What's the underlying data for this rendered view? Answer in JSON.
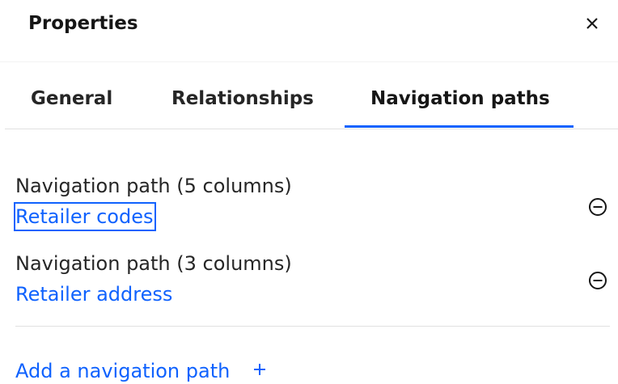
{
  "header": {
    "title": "Properties",
    "close_icon": "close-icon"
  },
  "tabs": [
    {
      "label": "General",
      "active": false
    },
    {
      "label": "Relationships",
      "active": false
    },
    {
      "label": "Navigation paths",
      "active": true
    }
  ],
  "navigation_paths": [
    {
      "heading": "Navigation path (5 columns)",
      "link": "Retailer codes",
      "focused": true,
      "remove_icon": "minus-circle-icon"
    },
    {
      "heading": "Navigation path (3 columns)",
      "link": "Retailer address",
      "focused": false,
      "remove_icon": "minus-circle-icon"
    }
  ],
  "add_action": {
    "label": "Add a navigation path",
    "icon": "plus-icon"
  },
  "colors": {
    "link": "#0f62fe",
    "text": "#262626",
    "divider": "#e0e0e0"
  }
}
